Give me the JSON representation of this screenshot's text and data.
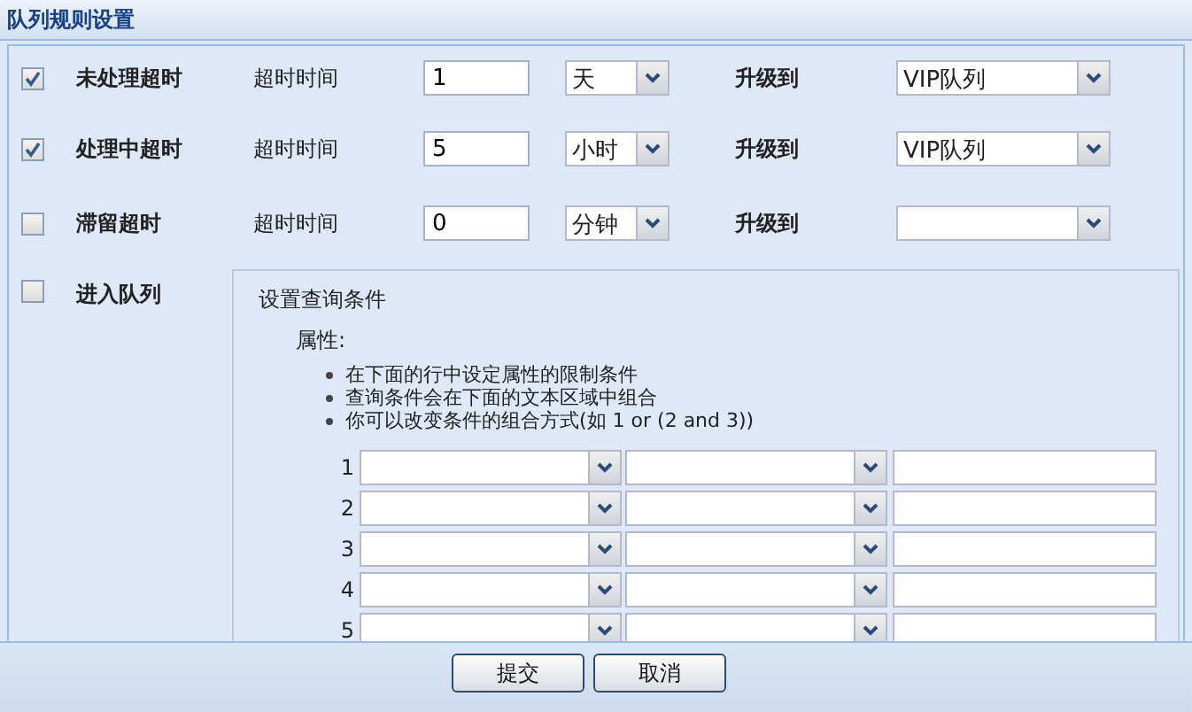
{
  "window": {
    "title": "队列规则设置"
  },
  "rules": [
    {
      "label": "未处理超时",
      "checked": true,
      "time_label": "超时时间",
      "time_value": "1",
      "unit": "天",
      "escalate_label": "升级到",
      "queue": "VIP队列"
    },
    {
      "label": "处理中超时",
      "checked": true,
      "time_label": "超时时间",
      "time_value": "5",
      "unit": "小时",
      "escalate_label": "升级到",
      "queue": "VIP队列"
    },
    {
      "label": "滞留超时",
      "checked": false,
      "time_label": "超时时间",
      "time_value": "0",
      "unit": "分钟",
      "escalate_label": "升级到"
    }
  ],
  "enter_queue": {
    "label": "进入队列",
    "checked": false
  },
  "query": {
    "title": "设置查询条件",
    "attr_label": "属性:",
    "hints": [
      "在下面的行中设定属性的限制条件",
      "查询条件会在下面的文本区域中组合",
      "你可以改变条件的组合方式(如 1 or (2 and 3))"
    ],
    "rows": [
      {
        "number": "1"
      },
      {
        "number": "2"
      },
      {
        "number": "3"
      },
      {
        "number": "4"
      },
      {
        "number": "5"
      }
    ]
  },
  "buttons": [
    "提交",
    "取消"
  ]
}
